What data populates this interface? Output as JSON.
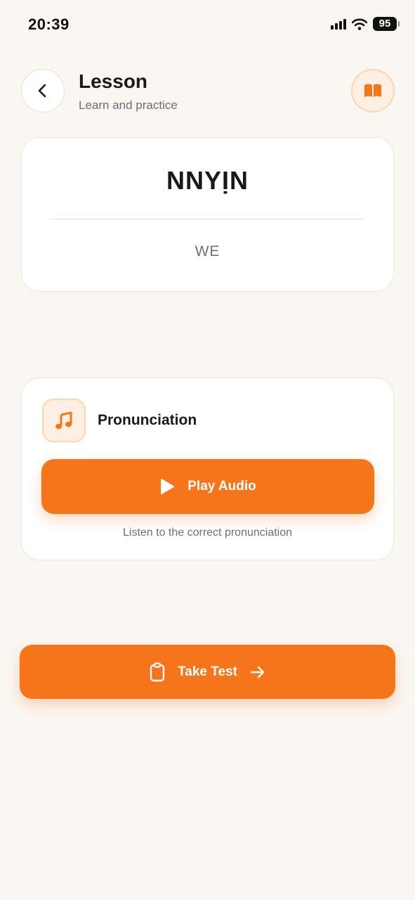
{
  "status_bar": {
    "time": "20:39",
    "battery": "95",
    "icons": [
      "signal-icon",
      "wifi-icon",
      "battery-icon"
    ]
  },
  "header": {
    "title": "Lesson",
    "subtitle": "Learn and practice",
    "back_icon": "chevron-left-icon",
    "book_icon": "book-open-icon"
  },
  "word_card": {
    "word": "NNYỊN",
    "translation": "WE"
  },
  "pronunciation": {
    "label": "Pronunciation",
    "icon": "music-note-icon",
    "play_label": "Play Audio",
    "play_icon": "play-icon",
    "hint": "Listen to the correct pronunciation"
  },
  "test": {
    "label": "Take Test",
    "left_icon": "clipboard-icon",
    "right_icon": "arrow-right-icon"
  },
  "colors": {
    "accent": "#f7751a",
    "accent_soft": "#fdf0e3",
    "background": "#faf6f2",
    "card": "#ffffff",
    "muted_text": "#6b6f76"
  }
}
